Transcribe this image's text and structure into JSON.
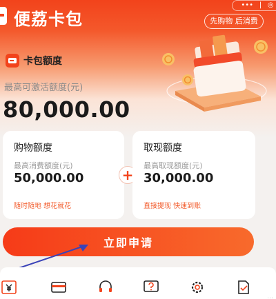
{
  "header": {
    "app_title": "便荔卡包",
    "menu_dots": "•••",
    "menu_separator": "|",
    "slogan": "先购物 后消费"
  },
  "card": {
    "title": "卡包额度",
    "max_label": "最高可激活额度(元)",
    "max_amount": "80,000.00"
  },
  "shopping": {
    "title": "购物额度",
    "label": "最高消费额度(元)",
    "amount": "50,000.00",
    "tag": "随时随地 想花就花"
  },
  "cash": {
    "title": "取现额度",
    "label": "最高取现额度(元)",
    "amount": "30,000.00",
    "tag": "直接提现 快速到账"
  },
  "plus_symbol": "+",
  "apply_button": "立即申请",
  "bottom_nav": [
    "yen-icon",
    "card-icon",
    "headset-icon",
    "help-icon",
    "settings-icon",
    "document-icon"
  ],
  "watermark": "…",
  "colors": {
    "brand": "#f2431b",
    "accent_text": "#f25a2a",
    "annotation_arrow": "#3b43b8"
  }
}
